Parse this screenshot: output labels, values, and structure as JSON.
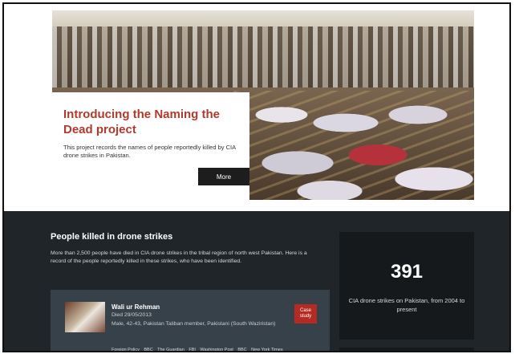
{
  "hero": {
    "title": "Introducing the Naming the Dead project",
    "description": "This project records the names of people reportedly killed by CIA drone strikes in Pakistan.",
    "more_label": "More"
  },
  "section": {
    "title": "People killed in drone strikes",
    "description": "More than 2,500 people have died in CIA drone strikes in the tribal region of north west Pakistan. Here is a record of the people reportedly killed in these strikes, who have been identified."
  },
  "case": {
    "name": "Wali ur Rehman",
    "died": "Died 29/05/2013",
    "info": "Male, 42-43, Pakistan Taliban member, Pakistani (South Waziristan)",
    "button_label": "Case study",
    "sources": [
      "Foreign Policy",
      "BBC",
      "The Guardian",
      "FBI",
      "Washington Post",
      "BBC",
      "New York Times"
    ]
  },
  "stat": {
    "number": "391",
    "label": "CIA drone strikes on Pakistan, from 2004 to present"
  }
}
